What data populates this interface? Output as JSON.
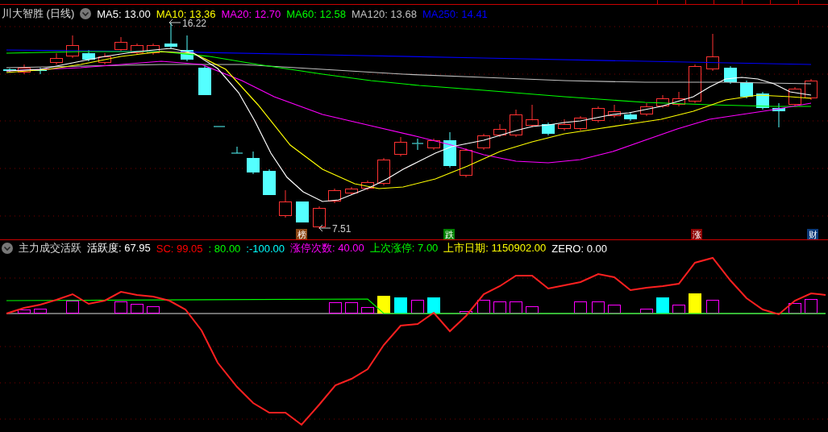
{
  "main_chart": {
    "title": "川大智胜 (日线)",
    "legend": [
      {
        "label": "MA5: 13.00",
        "color": "#ffffff"
      },
      {
        "label": "MA10: 13.36",
        "color": "#ffff00"
      },
      {
        "label": "MA20: 12.70",
        "color": "#ff00ff"
      },
      {
        "label": "MA60: 12.58",
        "color": "#00ff00"
      },
      {
        "label": "MA120: 13.68",
        "color": "#c0c0c0"
      },
      {
        "label": "MA250: 14.41",
        "color": "#0000ff"
      }
    ],
    "high_label": "16.22",
    "low_label": "7.51",
    "badges": [
      {
        "label": "榜",
        "color": "#8b4513"
      },
      {
        "label": "跌",
        "color": "#008000"
      },
      {
        "label": "涨",
        "color": "#8b0000"
      },
      {
        "label": "财",
        "color": "#0a3a7a"
      }
    ]
  },
  "indicator": {
    "title": "主力成交活跃",
    "values": [
      {
        "label": "活跃度: 67.95",
        "color": "#ffffff"
      },
      {
        "label": "SC: 99.05",
        "color": "#ff0000"
      },
      {
        "label": ": 80.00",
        "color": "#00ff00"
      },
      {
        "label": ":-100.00",
        "color": "#00ffff"
      },
      {
        "label": "涨停次数: 40.00",
        "color": "#ff00ff"
      },
      {
        "label": "上次涨停: 7.00",
        "color": "#00ff00"
      },
      {
        "label": "上市日期: 1150902.00",
        "color": "#ffff00"
      },
      {
        "label": "ZERO: 0.00",
        "color": "#ffffff"
      }
    ]
  }
}
